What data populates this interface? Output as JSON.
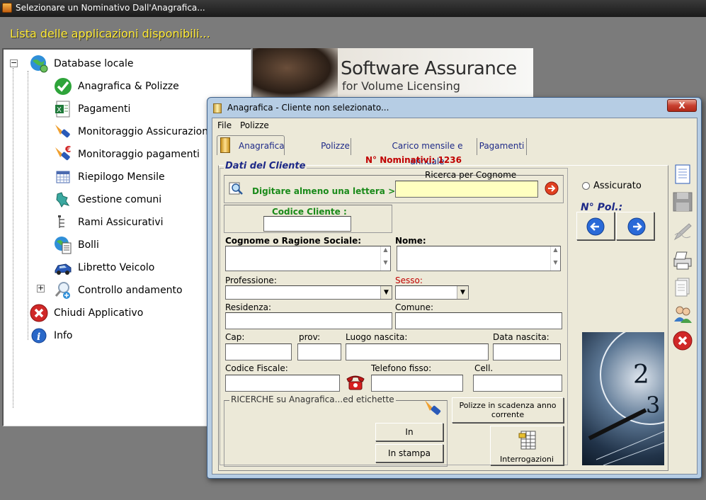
{
  "window": {
    "title": "Selezionare un Nominativo Dall'Anagrafica..."
  },
  "heading": "Lista delle applicazioni disponibili...",
  "tree": {
    "root": "Database locale",
    "items": [
      {
        "label": "Anagrafica & Polizze",
        "icon": "check-icon"
      },
      {
        "label": "Pagamenti",
        "icon": "excel-icon"
      },
      {
        "label": "Monitoraggio Assicurazioni",
        "icon": "flashlight-icon"
      },
      {
        "label": "Monitoraggio pagamenti",
        "icon": "flashlight-euro-icon"
      },
      {
        "label": "Riepilogo Mensile",
        "icon": "calendar-icon"
      },
      {
        "label": "Gestione comuni",
        "icon": "map-icon"
      },
      {
        "label": "Rami Assicurativi",
        "icon": "tree-structure-icon"
      },
      {
        "label": "Bolli",
        "icon": "document-globe-icon"
      },
      {
        "label": "Libretto Veicolo",
        "icon": "car-icon"
      },
      {
        "label": "Controllo andamento",
        "icon": "magnifier-icon"
      }
    ],
    "close_app": "Chiudi Applicativo",
    "info": "Info"
  },
  "banner": {
    "line1": "Software Assurance",
    "line2": "for Volume Licensing"
  },
  "dialog": {
    "title": "Anagrafica - Cliente non selezionato...",
    "close": "X",
    "menu": [
      "File",
      "Polizze"
    ],
    "tabs": [
      "Anagrafica",
      "Polizze",
      "Carico mensile e annuale",
      "Pagamenti"
    ],
    "nominativi": "N° Nominativi: 1236",
    "group_title": "Dati del Cliente",
    "ricerca_cognome": "Ricerca per Cognome",
    "digitare": "Digitare almeno una lettera  >",
    "codice_cliente": "Codice Cliente :",
    "cognome": "Cognome o Ragione Sociale:",
    "nome": "Nome:",
    "professione": "Professione:",
    "sesso": "Sesso:",
    "residenza": "Residenza:",
    "comune": "Comune:",
    "cap": "Cap:",
    "prov": "prov:",
    "luogo_nascita": "Luogo nascita:",
    "data_nascita": "Data nascita:",
    "codice_fiscale": "Codice Fiscale:",
    "telefono": "Telefono fisso:",
    "cell": "Cell.",
    "ricerche": "RICERCHE  su Anagrafica...ed etichette",
    "in_visualizzazione": "In visualizzazione",
    "in_stampa": "In stampa",
    "polizze_scadenza": "Polizze in scadenza anno corrente",
    "interrogazioni": "Interrogazioni",
    "assicurato": "Assicurato",
    "n_pol": "N° Pol.:"
  }
}
